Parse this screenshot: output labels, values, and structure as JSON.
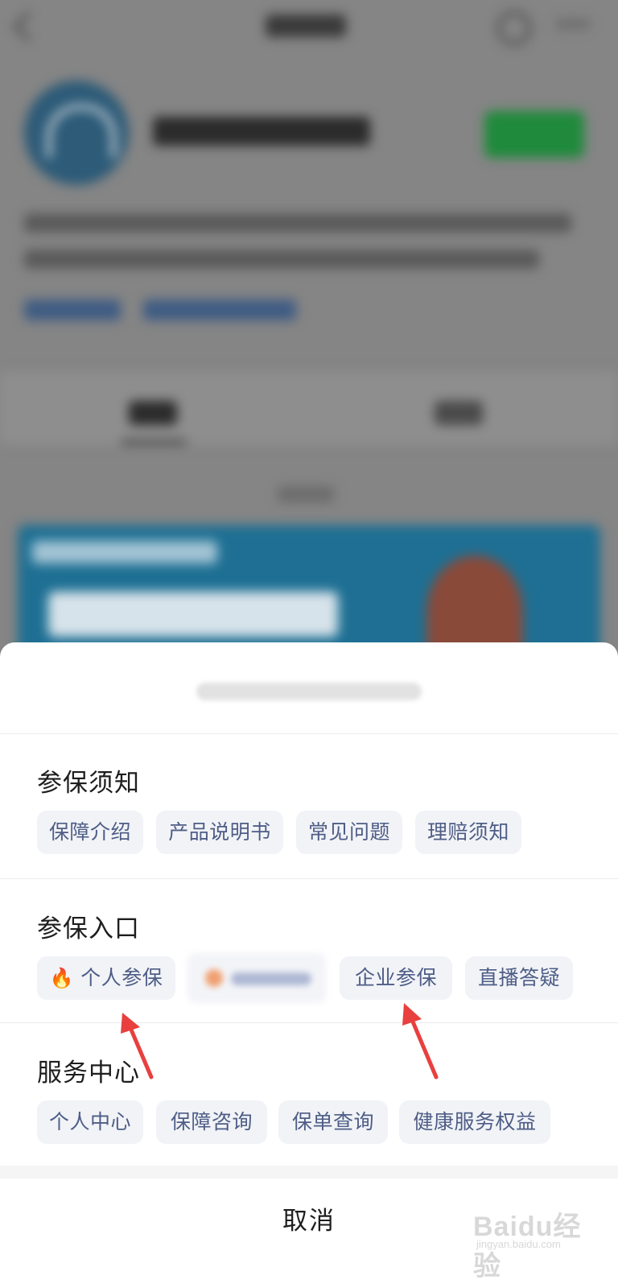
{
  "sheet": {
    "sections": [
      {
        "title": "参保须知",
        "chips": [
          "保障介绍",
          "产品说明书",
          "常见问题",
          "理赔须知"
        ]
      },
      {
        "title": "参保入口",
        "chips": [
          "个人参保",
          "企业参保",
          "直播答疑"
        ]
      },
      {
        "title": "服务中心",
        "chips": [
          "个人中心",
          "保障咨询",
          "保单查询",
          "健康服务权益"
        ]
      }
    ],
    "cancel_label": "取消"
  },
  "icons": {
    "fire": "fire-icon"
  },
  "colors": {
    "chip_bg": "#f1f3f7",
    "chip_text": "#4e5d86",
    "arrow": "#e8403f",
    "accent_green": "#1f8a3b"
  },
  "watermark": {
    "text": "Baidu经验",
    "sub": "jingyan.baidu.com"
  }
}
